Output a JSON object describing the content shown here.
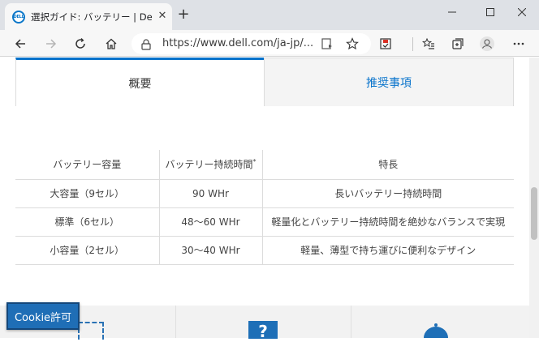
{
  "browser": {
    "tab_title": "選択ガイド: バッテリー | Dell 日本",
    "favicon_text": "DELL",
    "new_tab": "+",
    "tab_close": "✕",
    "url": "https://www.dell.com/ja-jp/..."
  },
  "page": {
    "tabs": [
      {
        "label": "概要"
      },
      {
        "label": "推奨事項"
      }
    ],
    "table": {
      "headers": [
        "バッテリー容量",
        "バッテリー持続時間",
        "特長"
      ],
      "header_footnote_mark": "*",
      "rows": [
        [
          "大容量（9セル）",
          "90 WHr",
          "長いバッテリー持続時間"
        ],
        [
          "標準（6セル）",
          "48～60 WHr",
          "軽量化とバッテリー持続時間を絶妙なバランスで実現"
        ],
        [
          "小容量（2セル）",
          "30～40 WHr",
          "軽量、薄型で持ち運びに便利なデザイン"
        ]
      ]
    },
    "band_icon_glyph": "?",
    "cookie_button": "Cookie許可"
  },
  "colors": {
    "accent": "#0672cb",
    "cookie_bg": "#1f6eb6"
  }
}
